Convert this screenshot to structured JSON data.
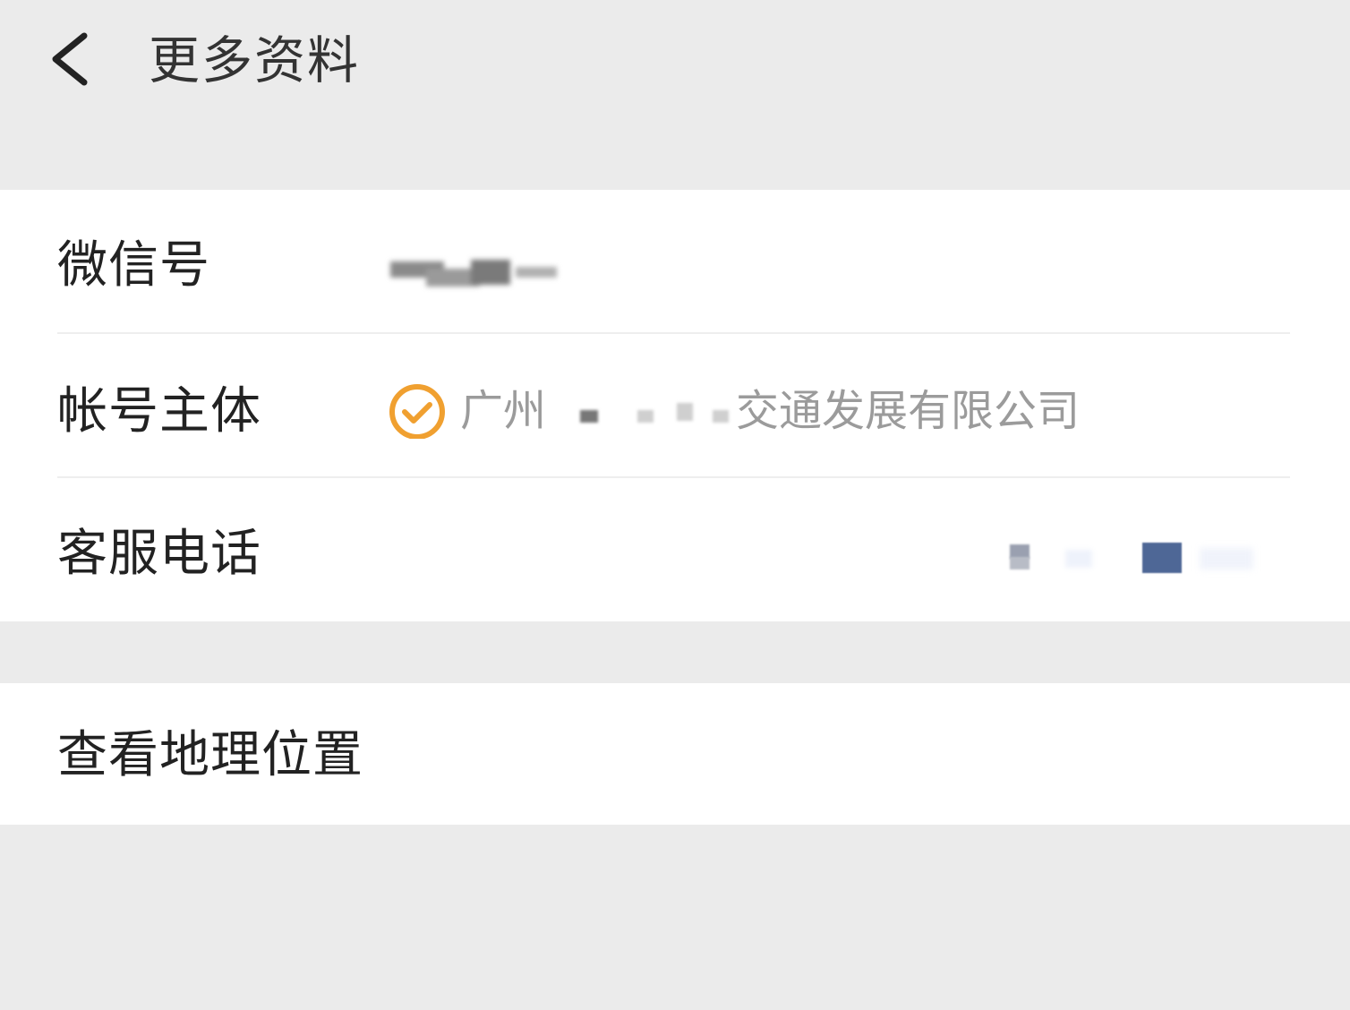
{
  "header": {
    "title": "更多资料",
    "back_icon": "chevron-left-icon"
  },
  "info": {
    "wechat_id": {
      "label": "微信号"
    },
    "account_entity": {
      "label": "帐号主体",
      "value_prefix": "广州",
      "value_suffix": "交通发展有限公司",
      "verified_icon": "verified-check-icon",
      "verified_color": "#f0a030"
    },
    "customer_phone": {
      "label": "客服电话"
    }
  },
  "location": {
    "label": "查看地理位置"
  },
  "colors": {
    "background": "#ebebeb",
    "card": "#ffffff",
    "label_text": "#222222",
    "value_text": "#9b9b9b"
  }
}
